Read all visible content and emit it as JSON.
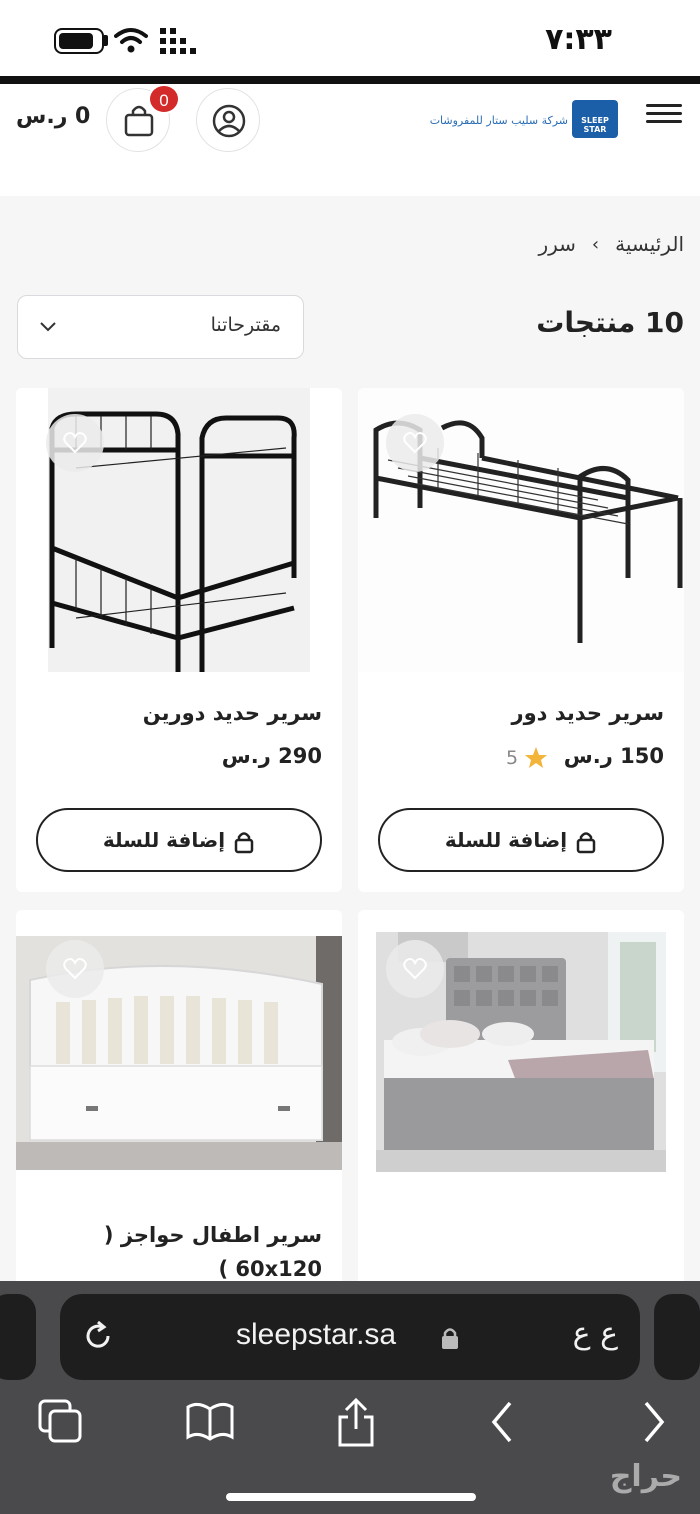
{
  "status_bar": {
    "time": "٧:٣٣"
  },
  "header": {
    "logo_text": "شركة سليب ستار للمفروشات",
    "logo_mark": "SLEEP STAR",
    "cart_badge": "0",
    "cart_total": "0 ر.س"
  },
  "breadcrumb": {
    "home": "الرئيسية",
    "separator": "›",
    "current": "سرر"
  },
  "listing": {
    "count_label": "10 منتجات",
    "sort_label": "مقترحاتنا"
  },
  "products": [
    {
      "name": "سرير حديد دور",
      "price": "150 ر.س",
      "rating": "5",
      "add_label": "إضافة للسلة"
    },
    {
      "name": "سرير حديد دورين",
      "price": "290 ر.س",
      "add_label": "إضافة للسلة"
    },
    {
      "name": ""
    },
    {
      "name": "سرير اطفال حواجز ( 60x120 )"
    }
  ],
  "browser": {
    "url": "sleepstar.sa",
    "aa_label": "ع ع",
    "watermark": "حراج"
  },
  "colors": {
    "badge": "#d32a2a",
    "star": "#f4b43a",
    "brand": "#1b5fa8"
  },
  "icons": [
    "menu-icon",
    "user-icon",
    "cart-icon",
    "chevron-down-icon",
    "heart-icon",
    "lock-icon",
    "star-icon",
    "reload-icon",
    "tabs-icon",
    "bookmarks-icon",
    "share-icon",
    "back-icon",
    "forward-icon"
  ]
}
